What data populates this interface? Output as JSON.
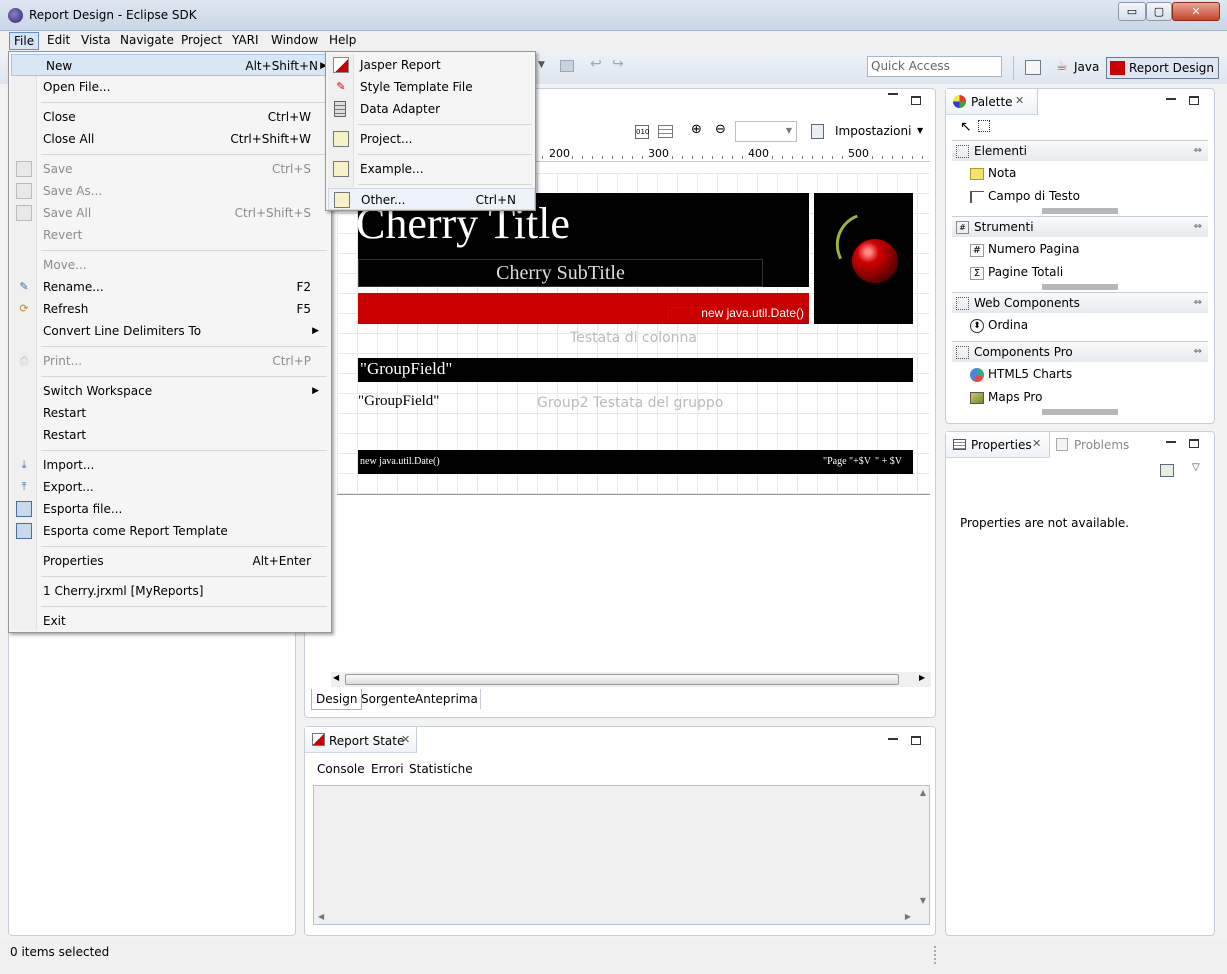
{
  "window": {
    "title": "Report Design - Eclipse SDK",
    "min": "▭",
    "max": "▢",
    "close": "✕"
  },
  "menubar": [
    "File",
    "Edit",
    "Vista",
    "Navigate",
    "Project",
    "YARI",
    "Window",
    "Help"
  ],
  "toolbar": {
    "quick_access": "Quick Access",
    "java": "Java",
    "report_design": "Report Design"
  },
  "file_menu": {
    "new": {
      "label": "New",
      "shortcut": "Alt+Shift+N"
    },
    "open_file": "Open File...",
    "close": {
      "label": "Close",
      "shortcut": "Ctrl+W"
    },
    "close_all": {
      "label": "Close All",
      "shortcut": "Ctrl+Shift+W"
    },
    "save": {
      "label": "Save",
      "shortcut": "Ctrl+S"
    },
    "save_as": "Save As...",
    "save_all": {
      "label": "Save All",
      "shortcut": "Ctrl+Shift+S"
    },
    "revert": "Revert",
    "move": "Move...",
    "rename": {
      "label": "Rename...",
      "shortcut": "F2"
    },
    "refresh": {
      "label": "Refresh",
      "shortcut": "F5"
    },
    "convert": "Convert Line Delimiters To",
    "print": {
      "label": "Print...",
      "shortcut": "Ctrl+P"
    },
    "switch_ws": "Switch Workspace",
    "restart1": "Restart",
    "restart2": "Restart",
    "import": "Import...",
    "export": "Export...",
    "esporta_file": "Esporta file...",
    "esporta_template": "Esporta come Report Template",
    "properties": {
      "label": "Properties",
      "shortcut": "Alt+Enter"
    },
    "recent": "1 Cherry.jrxml  [MyReports]",
    "exit": "Exit"
  },
  "new_submenu": {
    "jasper": "Jasper Report",
    "style": "Style Template File",
    "adapter": "Data Adapter",
    "project": "Project...",
    "example": "Example...",
    "other": {
      "label": "Other...",
      "shortcut": "Ctrl+N"
    }
  },
  "editor": {
    "impostazioni": "Impostazioni",
    "ruler": [
      "200",
      "300",
      "400",
      "500"
    ],
    "title": "Cherry Title",
    "subtitle": "Cherry SubTitle",
    "date_field": "new java.util.Date()",
    "column_header": "Testata di colonna",
    "group_field": "\"GroupField\"",
    "group2_field": "\"GroupField\"",
    "group2_header": "Group2 Testata del gruppo",
    "footer_date": "new java.util.Date()",
    "footer_page": "\"Page \"+$V",
    "footer_page2": "\" + $V",
    "tabs": [
      "Design",
      "Sorgente",
      "Anteprima"
    ]
  },
  "report_state": {
    "title": "Report State",
    "tabs": [
      "Console",
      "Errori",
      "Statistiche"
    ]
  },
  "palette": {
    "title": "Palette",
    "groups": [
      {
        "name": "Elementi",
        "items": [
          "Nota",
          "Campo di Testo"
        ]
      },
      {
        "name": "Strumenti",
        "items": [
          "Numero Pagina",
          "Pagine Totali"
        ]
      },
      {
        "name": "Web Components",
        "items": [
          "Ordina"
        ]
      },
      {
        "name": "Components Pro",
        "items": [
          "HTML5 Charts",
          "Maps Pro"
        ]
      }
    ]
  },
  "properties": {
    "title": "Properties",
    "problems": "Problems",
    "message": "Properties are not available."
  },
  "status": "0 items selected",
  "colors": {
    "red_band": "#cc0000",
    "black_band": "#000000",
    "menu_bg": "#f5f5f5"
  }
}
